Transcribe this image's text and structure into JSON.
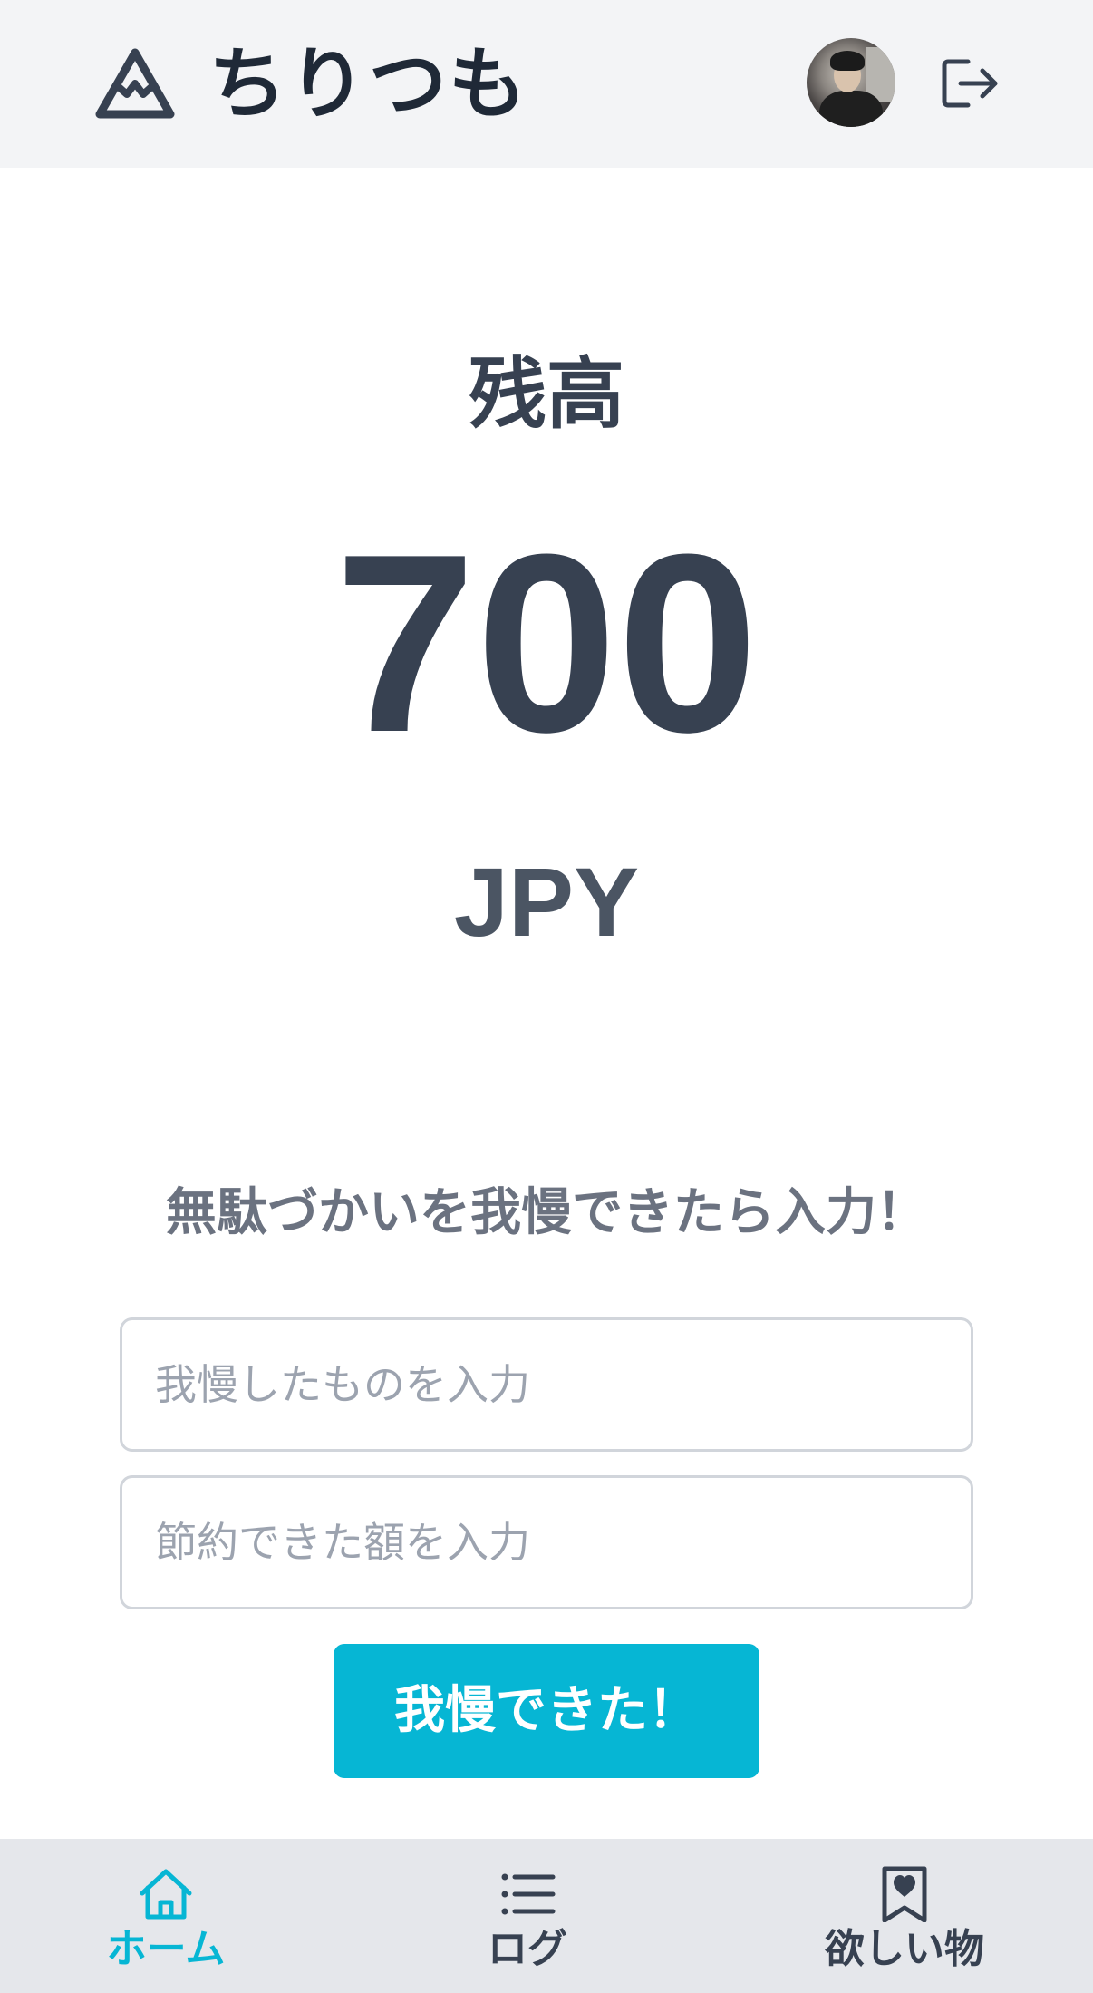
{
  "header": {
    "app_title": "ちりつも",
    "logo_icon": "mountain-icon",
    "avatar_icon": "user-avatar",
    "logout_icon": "logout-icon"
  },
  "balance": {
    "label": "残高",
    "amount": "700",
    "currency": "JPY"
  },
  "form": {
    "heading": "無駄づかいを我慢できたら入力！",
    "item_placeholder": "我慢したものを入力",
    "item_value": "",
    "amount_placeholder": "節約できた額を入力",
    "amount_value": "",
    "submit_label": "我慢できた！"
  },
  "bottom_nav": {
    "items": [
      {
        "label": "ホーム",
        "icon": "home-icon",
        "active": true
      },
      {
        "label": "ログ",
        "icon": "list-icon",
        "active": false
      },
      {
        "label": "欲しい物",
        "icon": "bookmark-heart-icon",
        "active": false
      }
    ]
  },
  "colors": {
    "accent": "#06b6d4",
    "header_bg": "#f3f4f6",
    "nav_bg": "#e5e7eb",
    "text_dark": "#374151",
    "text_muted": "#6b7280"
  }
}
